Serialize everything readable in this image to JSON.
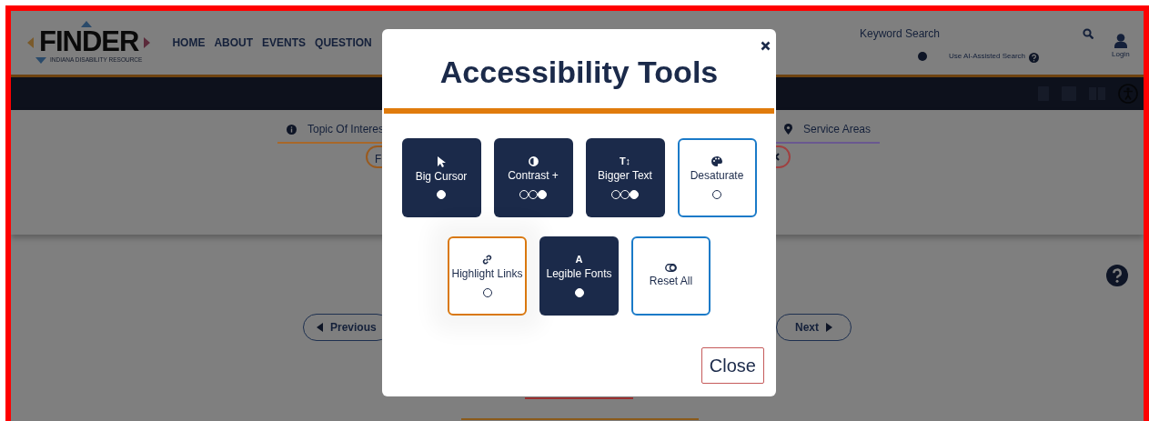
{
  "logo": {
    "name": "FINDER",
    "tagline": "INDIANA DISABILITY RESOURCE"
  },
  "nav": [
    "HOME",
    "ABOUT",
    "EVENTS",
    "QUESTION"
  ],
  "search": {
    "placeholder": "Keyword Search",
    "ai_label": "Use AI-Assisted Search"
  },
  "login": "Login",
  "tabs": [
    {
      "label": "Topic Of Interes",
      "color": "#a8682a"
    },
    {
      "label": "Service Areas",
      "color": "#6a5890"
    }
  ],
  "filter_pill": "F",
  "pagination": {
    "previous": "Previous",
    "next": "Next"
  },
  "modal": {
    "title": "Accessibility Tools",
    "close_label": "Close",
    "tools": [
      {
        "label": "Big Cursor",
        "on": true,
        "focused": false,
        "dots": [
          {
            "filled": true
          }
        ]
      },
      {
        "label": "Contrast +",
        "on": true,
        "focused": false,
        "dots": [
          {
            "filled": false
          },
          {
            "filled": false
          },
          {
            "filled": true
          }
        ]
      },
      {
        "label": "Bigger Text",
        "glyph": "T↕",
        "on": true,
        "focused": false,
        "dots": [
          {
            "filled": false
          },
          {
            "filled": false
          },
          {
            "filled": true
          }
        ]
      },
      {
        "label": "Desaturate",
        "on": false,
        "focused": false,
        "dots": [
          {
            "filled": false
          }
        ]
      },
      {
        "label": "Highlight Links",
        "on": false,
        "focused": true,
        "dots": [
          {
            "filled": false
          }
        ]
      },
      {
        "label": "Legible Fonts",
        "glyph": "A",
        "on": true,
        "focused": false,
        "dots": [
          {
            "filled": true
          }
        ]
      },
      {
        "label": "Reset All",
        "on": false,
        "focused": false
      }
    ]
  }
}
